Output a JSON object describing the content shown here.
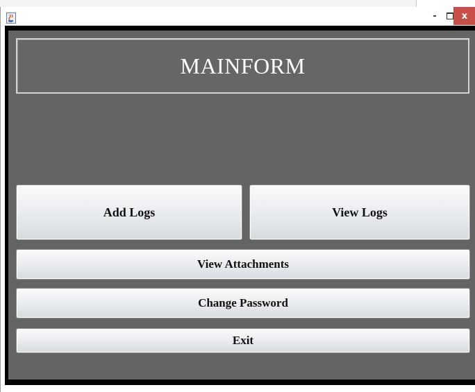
{
  "window": {
    "controls": {
      "minimize": "-",
      "close": "x"
    },
    "icons": {
      "app": "java-coffee-icon",
      "maximize": "maximize-icon"
    }
  },
  "header": {
    "title": "MAINFORM"
  },
  "buttons": {
    "add_logs": "Add Logs",
    "view_logs": "View Logs",
    "view_attachments": "View Attachments",
    "change_password": "Change Password",
    "exit": "Exit"
  },
  "colors": {
    "panel_bg": "#646464",
    "frame_border": "#000000",
    "close_button": "#c7504a",
    "header_text": "#ffffff"
  }
}
